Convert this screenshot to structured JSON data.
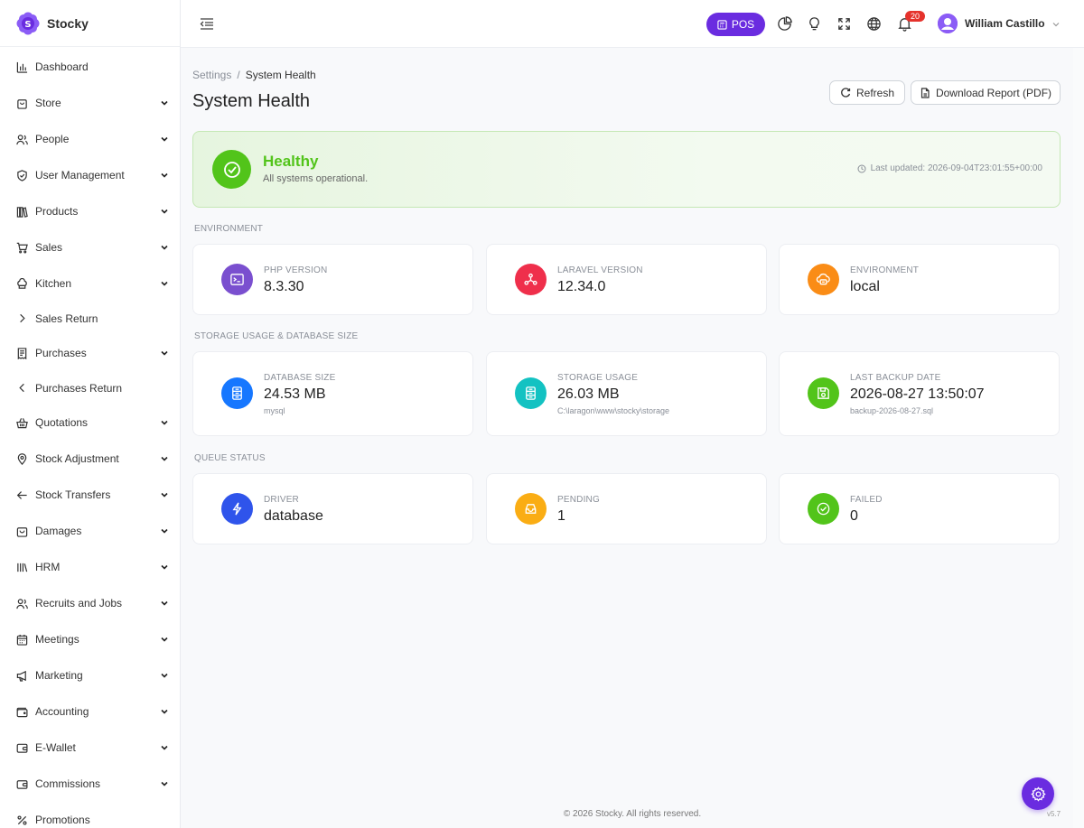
{
  "app": {
    "name": "Stocky",
    "brand_color": "#6a2ce0"
  },
  "sidebar": {
    "items": [
      {
        "label": "Dashboard",
        "icon": "bar-chart-icon",
        "has_chevron": false
      },
      {
        "label": "Store",
        "icon": "store-bag-icon",
        "has_chevron": true
      },
      {
        "label": "People",
        "icon": "people-icon",
        "has_chevron": true
      },
      {
        "label": "User Management",
        "icon": "shield-icon",
        "has_chevron": true
      },
      {
        "label": "Products",
        "icon": "books-icon",
        "has_chevron": true
      },
      {
        "label": "Sales",
        "icon": "cart-icon",
        "has_chevron": true
      },
      {
        "label": "Kitchen",
        "icon": "chef-hat-icon",
        "has_chevron": true
      },
      {
        "label": "Sales Return",
        "icon": "chevron-right-icon",
        "has_chevron": false
      },
      {
        "label": "Purchases",
        "icon": "receipt-icon",
        "has_chevron": true
      },
      {
        "label": "Purchases Return",
        "icon": "chevron-left-icon",
        "has_chevron": false
      },
      {
        "label": "Quotations",
        "icon": "basket-icon",
        "has_chevron": true
      },
      {
        "label": "Stock Adjustment",
        "icon": "map-pin-icon",
        "has_chevron": true
      },
      {
        "label": "Stock Transfers",
        "icon": "arrow-left-icon",
        "has_chevron": true
      },
      {
        "label": "Damages",
        "icon": "bag-icon",
        "has_chevron": true
      },
      {
        "label": "HRM",
        "icon": "library-icon",
        "has_chevron": true
      },
      {
        "label": "Recruits and Jobs",
        "icon": "users-icon",
        "has_chevron": true
      },
      {
        "label": "Meetings",
        "icon": "calendar-icon",
        "has_chevron": true
      },
      {
        "label": "Marketing",
        "icon": "megaphone-icon",
        "has_chevron": true
      },
      {
        "label": "Accounting",
        "icon": "wallet-icon",
        "has_chevron": true
      },
      {
        "label": "E-Wallet",
        "icon": "ewallet-icon",
        "has_chevron": true
      },
      {
        "label": "Commissions",
        "icon": "commission-icon",
        "has_chevron": true
      },
      {
        "label": "Promotions",
        "icon": "percent-icon",
        "has_chevron": false
      }
    ]
  },
  "topbar": {
    "pos_label": "POS",
    "notification_count": "20",
    "user_name": "William Castillo"
  },
  "breadcrumb": {
    "parent": "Settings",
    "separator": "/",
    "current": "System Health"
  },
  "page": {
    "title": "System Health",
    "refresh_label": "Refresh",
    "download_label": "Download Report (PDF)"
  },
  "health": {
    "status": "Healthy",
    "message": "All systems operational.",
    "last_updated": "Last updated: 2026-09-04T23:01:55+00:00",
    "color": "#52c41a"
  },
  "sections": {
    "environment": "ENVIRONMENT",
    "storage": "STORAGE USAGE & DATABASE SIZE",
    "queue": "QUEUE STATUS"
  },
  "environment_cards": [
    {
      "label": "PHP VERSION",
      "value": "8.3.30",
      "color": "#7a4fcf"
    },
    {
      "label": "LARAVEL VERSION",
      "value": "12.34.0",
      "color": "#ef2f4b"
    },
    {
      "label": "ENVIRONMENT",
      "value": "local",
      "color": "#fa8c16"
    }
  ],
  "storage_cards": [
    {
      "label": "DATABASE SIZE",
      "value": "24.53 MB",
      "sub": "mysql",
      "color": "#1677ff"
    },
    {
      "label": "STORAGE USAGE",
      "value": "26.03 MB",
      "sub": "C:\\laragon\\www\\stocky\\storage",
      "color": "#13c2c2"
    },
    {
      "label": "LAST BACKUP DATE",
      "value": "2026-08-27 13:50:07",
      "sub": "backup-2026-08-27.sql",
      "color": "#52c41a"
    }
  ],
  "queue_cards": [
    {
      "label": "DRIVER",
      "value": "database",
      "color": "#2f54eb"
    },
    {
      "label": "PENDING",
      "value": "1",
      "color": "#faad14"
    },
    {
      "label": "FAILED",
      "value": "0",
      "color": "#52c41a"
    }
  ],
  "footer": {
    "copyright": "© 2026 Stocky. All rights reserved.",
    "version": "v5.7"
  }
}
